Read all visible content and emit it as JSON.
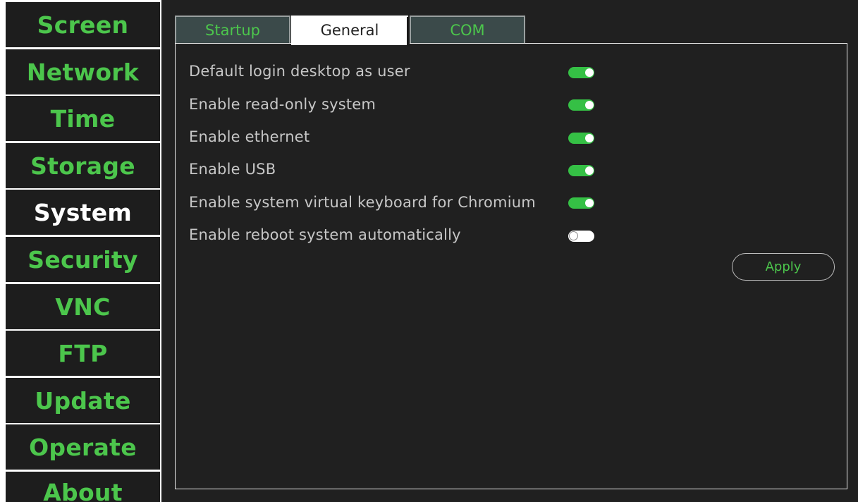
{
  "sidebar": {
    "items": [
      {
        "label": "Screen"
      },
      {
        "label": "Network"
      },
      {
        "label": "Time"
      },
      {
        "label": "Storage"
      },
      {
        "label": "System"
      },
      {
        "label": "Security"
      },
      {
        "label": "VNC"
      },
      {
        "label": "FTP"
      },
      {
        "label": "Update"
      },
      {
        "label": "Operate"
      },
      {
        "label": "About"
      }
    ],
    "active": "System"
  },
  "tabs": [
    {
      "label": "Startup"
    },
    {
      "label": "General"
    },
    {
      "label": "COM"
    }
  ],
  "active_tab": "General",
  "settings": [
    {
      "label": "Default login desktop as user",
      "enabled": true
    },
    {
      "label": "Enable read-only system",
      "enabled": true
    },
    {
      "label": "Enable ethernet",
      "enabled": true
    },
    {
      "label": "Enable USB",
      "enabled": true
    },
    {
      "label": "Enable system virtual keyboard for Chromium",
      "enabled": true
    },
    {
      "label": "Enable reboot system automatically",
      "enabled": false
    }
  ],
  "apply_label": "Apply",
  "colors": {
    "accent_green": "#4cc64c",
    "toggle_on": "#35c045",
    "background": "#202020"
  }
}
